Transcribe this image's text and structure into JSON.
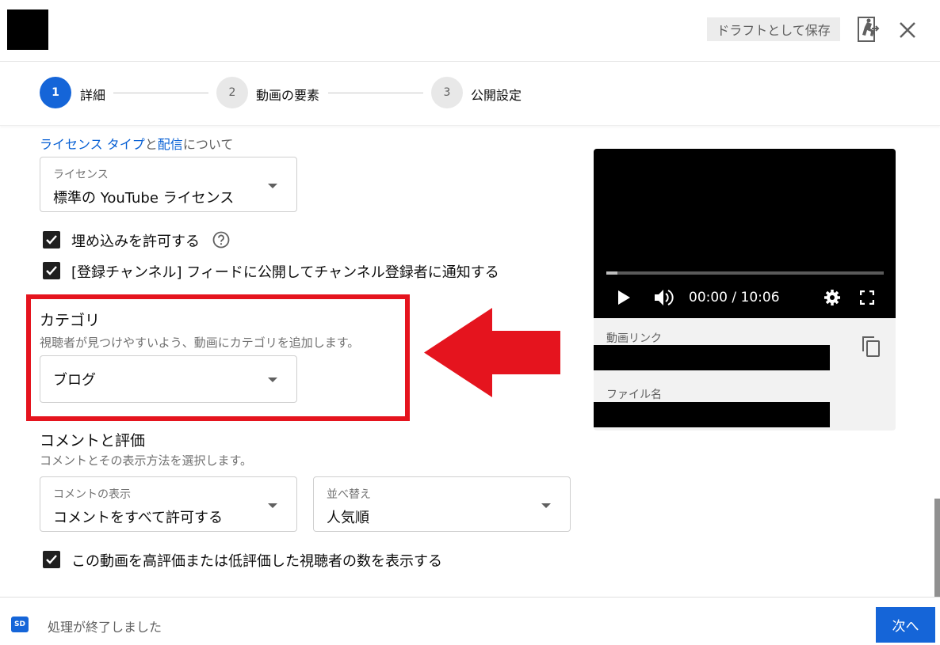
{
  "header": {
    "save_draft_label": "ドラフトとして保存",
    "icons": [
      "feedback-icon",
      "close-icon"
    ]
  },
  "stepper": {
    "steps": [
      {
        "number": "1",
        "label": "詳細",
        "active": true
      },
      {
        "number": "2",
        "label": "動画の要素",
        "active": false
      },
      {
        "number": "3",
        "label": "公開設定",
        "active": false
      }
    ]
  },
  "license": {
    "link_license_type": "ライセンス タイプ",
    "and": "と",
    "link_distribution": "配信",
    "about": "について",
    "dropdown_label": "ライセンス",
    "dropdown_value": "標準の YouTube ライセンス"
  },
  "checkboxes": {
    "allow_embedding": "埋め込みを許可する",
    "publish_to_feed": "[登録チャンネル] フィードに公開してチャンネル登録者に通知する",
    "show_rating_count": "この動画を高評価または低評価した視聴者の数を表示する"
  },
  "category": {
    "title": "カテゴリ",
    "description": "視聴者が見つけやすいよう、動画にカテゴリを追加します。",
    "value": "ブログ"
  },
  "comments": {
    "title": "コメントと評価",
    "description": "コメントとその表示方法を選択します。",
    "visibility_label": "コメントの表示",
    "visibility_value": "コメントをすべて許可する",
    "sort_label": "並べ替え",
    "sort_value": "人気順"
  },
  "preview": {
    "time": "00:00 / 10:06",
    "progress": 0.04,
    "video_link_label": "動画リンク",
    "file_name_label": "ファイル名"
  },
  "footer": {
    "badge": "SD",
    "status": "処理が終了しました",
    "next_label": "次へ"
  },
  "colors": {
    "accent": "#1565d8",
    "highlight": "#e5141e",
    "link": "#065fd4"
  }
}
